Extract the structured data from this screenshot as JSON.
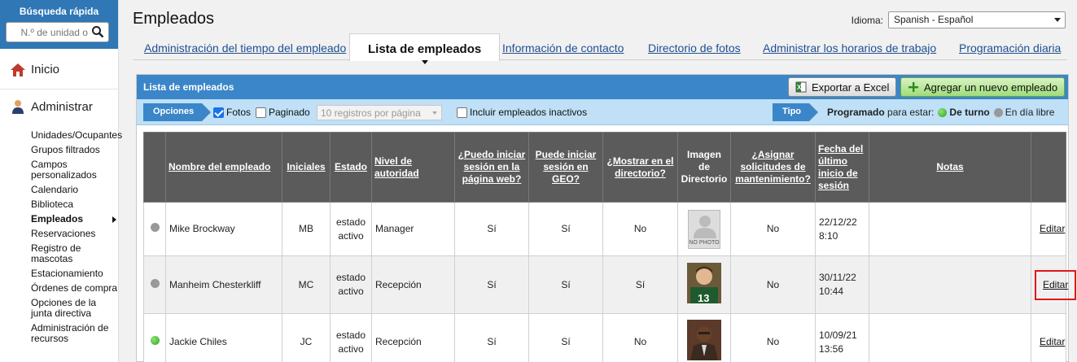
{
  "sidebar": {
    "quick_search_title": "Búsqueda rápida",
    "quick_search_placeholder": "N.º de unidad o",
    "home_label": "Inicio",
    "admin_label": "Administrar",
    "items": [
      {
        "label": "Unidades/Ocupantes",
        "active": false
      },
      {
        "label": "Grupos filtrados",
        "active": false
      },
      {
        "label": "Campos personalizados",
        "active": false
      },
      {
        "label": "Calendario",
        "active": false
      },
      {
        "label": "Biblioteca",
        "active": false
      },
      {
        "label": "Empleados",
        "active": true
      },
      {
        "label": "Reservaciones",
        "active": false
      },
      {
        "label": "Registro de mascotas",
        "active": false
      },
      {
        "label": "Estacionamiento",
        "active": false
      },
      {
        "label": "Órdenes de compra",
        "active": false
      },
      {
        "label": "Opciones de la junta directiva",
        "active": false
      },
      {
        "label": "Administración de recursos",
        "active": false
      }
    ]
  },
  "header": {
    "title": "Empleados",
    "language_label": "Idioma:",
    "language_value": "Spanish - Español"
  },
  "tabs": [
    {
      "label": "Administración del tiempo del empleado",
      "active": false
    },
    {
      "label": "Lista de empleados",
      "active": true
    },
    {
      "label": "Información de contacto",
      "active": false
    },
    {
      "label": "Directorio de fotos",
      "active": false
    },
    {
      "label": "Administrar los horarios de trabajo",
      "active": false
    },
    {
      "label": "Programación diaria",
      "active": false
    }
  ],
  "panel": {
    "title": "Lista de empleados",
    "export_label": "Exportar a Excel",
    "add_label": "Agregar un nuevo empleado"
  },
  "options": {
    "label": "Opciones",
    "photos_label": "Fotos",
    "photos_checked": true,
    "paged_label": "Paginado",
    "paged_checked": false,
    "per_page_value": "10 registros por página",
    "inactive_label": "Incluir empleados inactivos",
    "inactive_checked": false,
    "type_label": "Tipo",
    "scheduled_bold": "Programado",
    "scheduled_rest": "para estar:",
    "on_shift": "De turno",
    "day_off": "En día libre"
  },
  "table": {
    "headers": {
      "name": "Nombre del empleado",
      "initials": "Iniciales",
      "status": "Estado",
      "authority": "Nivel de autoridad",
      "web_login": "¿Puedo iniciar sesión en la página web?",
      "geo_login": "Puede iniciar sesión en GEO?",
      "show_directory": "¿Mostrar en el directorio?",
      "directory_image": "Imagen de Directorio",
      "maintenance": "¿Asignar solicitudes de mantenimiento?",
      "last_login": "Fecha del último inicio de sesión",
      "notes": "Notas"
    },
    "no_photo_text": "NO PHOTO",
    "rows": [
      {
        "name": "Mike Brockway",
        "initials": "MB",
        "status": "estado activo",
        "authority": "Manager",
        "web": "Sí",
        "geo": "Sí",
        "directory": "No",
        "maintenance": "No",
        "last_login_date": "22/12/22",
        "last_login_time": "8:10",
        "notes": "",
        "edit": "Editar",
        "on_shift": false,
        "photo": "none"
      },
      {
        "name": "Manheim Chesterkliff",
        "initials": "MC",
        "status": "estado activo",
        "authority": "Recepción",
        "web": "Sí",
        "geo": "Sí",
        "directory": "Sí",
        "maintenance": "No",
        "last_login_date": "30/11/22",
        "last_login_time": "10:44",
        "notes": "",
        "edit": "Editar",
        "on_shift": false,
        "photo": "football"
      },
      {
        "name": "Jackie Chiles",
        "initials": "JC",
        "status": "estado activo",
        "authority": "Recepción",
        "web": "Sí",
        "geo": "Sí",
        "directory": "No",
        "maintenance": "No",
        "last_login_date": "10/09/21",
        "last_login_time": "13:56",
        "notes": "",
        "edit": "Editar",
        "on_shift": true,
        "photo": "suit"
      }
    ]
  }
}
